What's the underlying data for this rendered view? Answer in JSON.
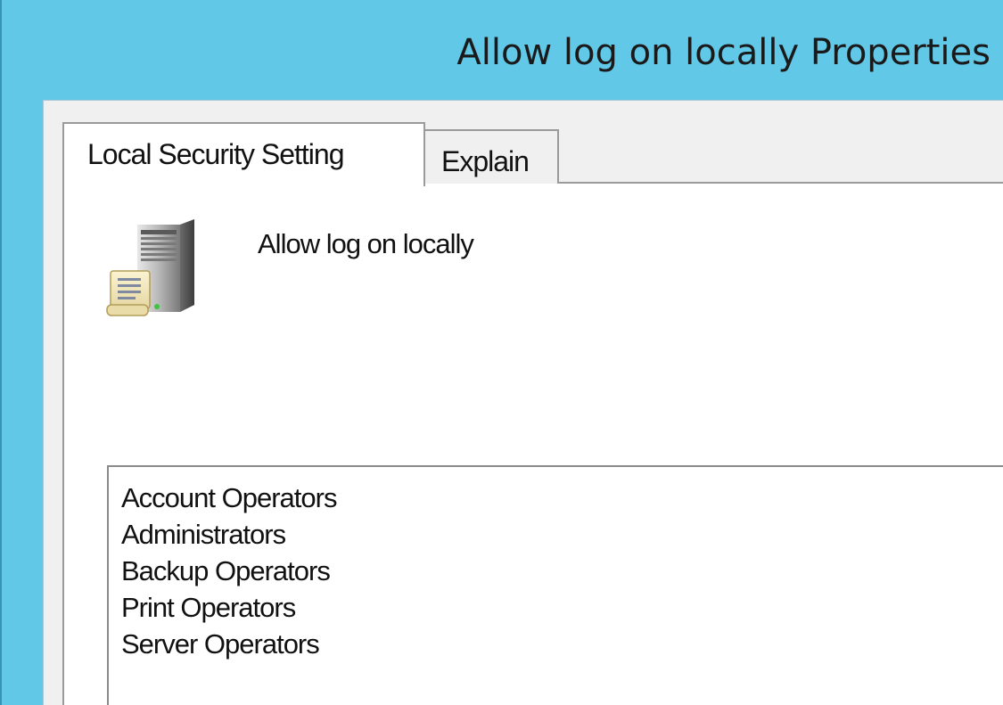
{
  "window": {
    "title": "Allow log on locally Properties"
  },
  "tabs": [
    {
      "label": "Local Security Setting",
      "selected": true
    },
    {
      "label": "Explain",
      "selected": false
    }
  ],
  "policy": {
    "icon": "server-policy-icon",
    "name": "Allow log on locally"
  },
  "members": [
    "Account Operators",
    "Administrators",
    "Backup Operators",
    "Print Operators",
    "Server Operators"
  ],
  "colors": {
    "titlebar": "#62c8e8",
    "dialog_background": "#f0f0f0",
    "panel_background": "#ffffff",
    "border": "#9a9a9a"
  }
}
